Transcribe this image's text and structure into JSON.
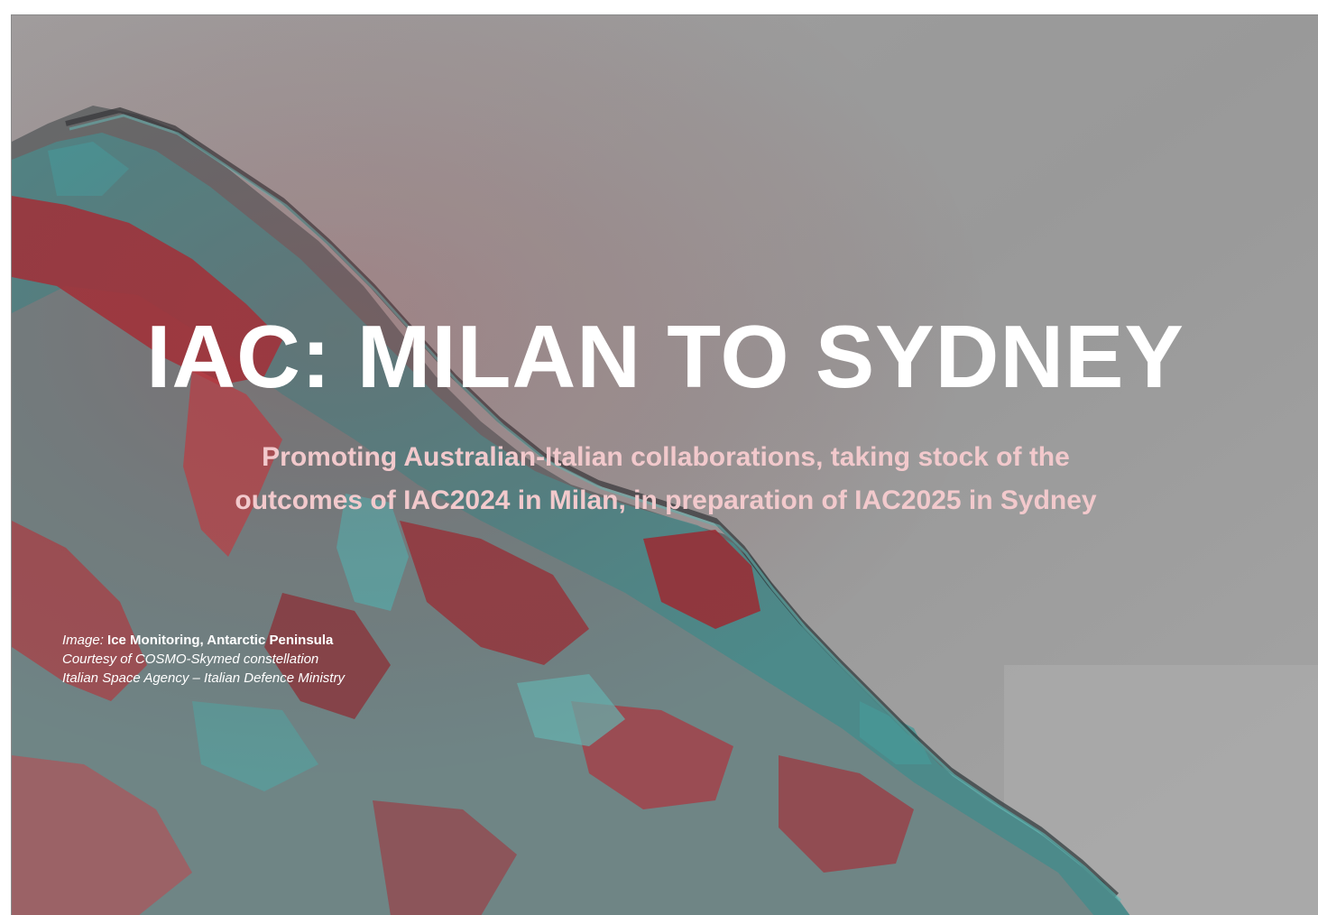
{
  "slide": {
    "title": "IAC: MILAN TO SYDNEY",
    "subtitle_line1": "Promoting Australian-Italian collaborations, taking stock of the",
    "subtitle_line2": "outcomes of IAC2024 in Milan, in preparation of IAC2025 in Sydney",
    "credit": {
      "label": "Image:",
      "subject": "Ice Monitoring, Antarctic Peninsula",
      "line2": "Courtesy of COSMO-Skymed constellation",
      "line3": "Italian Space Agency  – Italian Defence Ministry"
    }
  },
  "colors": {
    "background_gray": "#9a9a9a",
    "ice_red": "#a8222c",
    "ice_teal": "#3fa6a4",
    "title_white": "#ffffff",
    "subtitle_pink": "#f2c9cc"
  }
}
